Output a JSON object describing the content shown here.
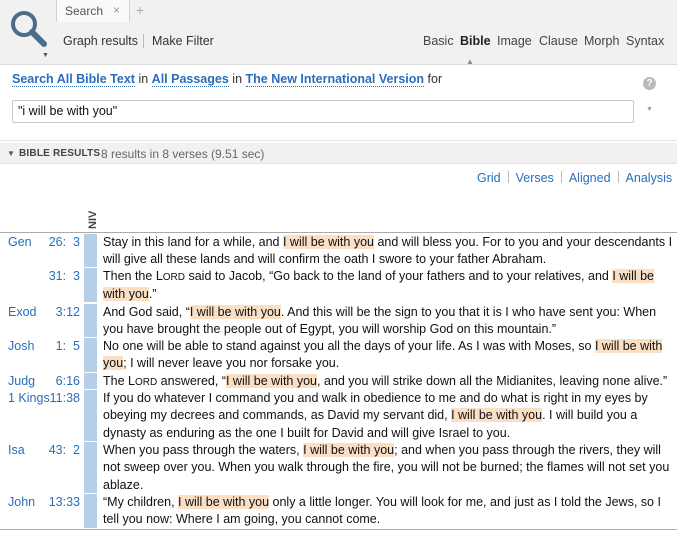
{
  "tab": {
    "label": "Search",
    "close": "×",
    "add": "+"
  },
  "toolbar": {
    "graph_results": "Graph results",
    "make_filter": "Make Filter",
    "modes": [
      "Basic",
      "Bible",
      "Image",
      "Clause",
      "Morph",
      "Syntax"
    ],
    "active_mode": "Bible"
  },
  "search_desc": {
    "scope": "Search All Bible Text",
    "in1": "in",
    "passages": "All Passages",
    "in2": "in",
    "version": "The New International Version",
    "for": "for"
  },
  "help": "?",
  "query": "\"i will be with you\"",
  "results_header": {
    "title": "BIBLE RESULTS",
    "summary": "8 results in 8 verses (9.51 sec)"
  },
  "view_links": [
    "Grid",
    "Verses",
    "Aligned",
    "Analysis"
  ],
  "column_version": "NIV",
  "results": [
    {
      "book": "Gen",
      "cv": "26:  3",
      "pre": "Stay in this land for a while, and ",
      "hl": "I will be with you",
      "post": " and will bless you. For to you and your descendants I will give all these lands and will confirm the oath I swore to your father Abraham."
    },
    {
      "book": "",
      "cv": "31:  3",
      "pre": "Then the L",
      "sc": "ORD",
      "mid": " said to Jacob, “Go back to the land of your fathers and to your relatives, and ",
      "hl": "I will be with you",
      "post": ".”"
    },
    {
      "book": "Exod",
      "cv": "3:12",
      "pre": "And God said, “",
      "hl": "I will be with you",
      "post": ". And this will be the sign to you that it is I who have sent you: When you have brought the people out of Egypt, you will worship God on this mountain.”"
    },
    {
      "book": "Josh",
      "cv": "1:  5",
      "pre": "No one will be able to stand against you all the days of your life. As I was with Moses, so ",
      "hl": "I will be with you",
      "post": "; I will never leave you nor forsake you."
    },
    {
      "book": "Judg",
      "cv": "6:16",
      "pre": "The L",
      "sc": "ORD",
      "mid": " answered, “",
      "hl": "I will be with you",
      "post": ", and you will strike down all the Midianites, leaving none alive.”"
    },
    {
      "book": "1 Kings",
      "cv": "11:38",
      "pre": "If you do whatever I command you and walk in obedience to me and do what is right in my eyes by obeying my decrees and commands, as David my servant did, ",
      "hl": "I will be with you",
      "post": ". I will build you a dynasty as enduring as the one I built for David and will give Israel to you."
    },
    {
      "book": "Isa",
      "cv": "43:  2",
      "pre": "When you pass through the waters, ",
      "hl": "I will be with you",
      "post": "; and when you pass through the rivers, they will not sweep over you. When you walk through the fire, you will not be burned; the flames will not set you ablaze."
    },
    {
      "book": "John",
      "cv": "13:33",
      "pre": "“My children, ",
      "hl": "I will be with you",
      "post": " only a little longer. You will look for me, and just as I told the Jews, so I tell you now: Where I am going, you cannot come."
    }
  ]
}
